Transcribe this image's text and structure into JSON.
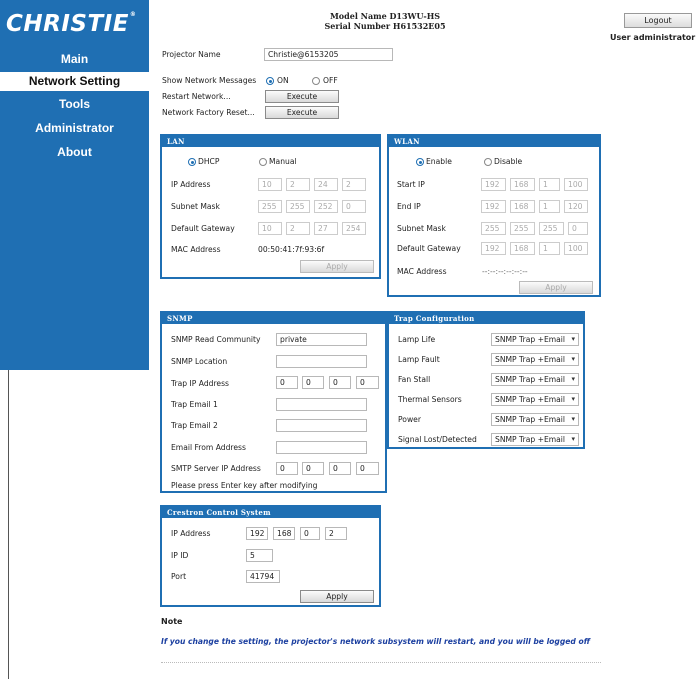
{
  "brand": {
    "logo_text": "CHRISTIE",
    "logo_mark": "®"
  },
  "nav": {
    "items": [
      {
        "label": "Main"
      },
      {
        "label": "Network Setting"
      },
      {
        "label": "Tools"
      },
      {
        "label": "Administrator"
      },
      {
        "label": "About"
      }
    ],
    "active_index": 1
  },
  "header": {
    "model_name": "Model Name D13WU-HS",
    "serial_number": "Serial Number H61532E05",
    "logout_label": "Logout",
    "user_label": "User administrator"
  },
  "general": {
    "projector_name_label": "Projector Name",
    "projector_name_value": "Christie@6153205",
    "show_messages_label": "Show Network Messages",
    "on_label": "ON",
    "off_label": "OFF",
    "show_messages_selected": "ON",
    "restart_label": "Restart Network...",
    "factory_reset_label": "Network Factory Reset...",
    "execute_label": "Execute"
  },
  "lan": {
    "title": "LAN",
    "dhcp_label": "DHCP",
    "manual_label": "Manual",
    "mode_selected": "DHCP",
    "ip_label": "IP Address",
    "ip": [
      "10",
      "2",
      "24",
      "2"
    ],
    "subnet_label": "Subnet Mask",
    "subnet": [
      "255",
      "255",
      "252",
      "0"
    ],
    "gateway_label": "Default Gateway",
    "gateway": [
      "10",
      "2",
      "27",
      "254"
    ],
    "mac_label": "MAC Address",
    "mac_value": "00:50:41:7f:93:6f",
    "apply_label": "Apply"
  },
  "wlan": {
    "title": "WLAN",
    "enable_label": "Enable",
    "disable_label": "Disable",
    "state_selected": "Enable",
    "start_ip_label": "Start IP",
    "start_ip": [
      "192",
      "168",
      "1",
      "100"
    ],
    "end_ip_label": "End IP",
    "end_ip": [
      "192",
      "168",
      "1",
      "120"
    ],
    "subnet_label": "Subnet Mask",
    "subnet": [
      "255",
      "255",
      "255",
      "0"
    ],
    "gateway_label": "Default Gateway",
    "gateway": [
      "192",
      "168",
      "1",
      "100"
    ],
    "mac_label": "MAC Address",
    "mac_value": "--:--:--:--:--:--",
    "apply_label": "Apply"
  },
  "snmp": {
    "title": "SNMP",
    "read_community_label": "SNMP Read Community",
    "read_community_value": "private",
    "location_label": "SNMP Location",
    "location_value": "",
    "trap_ip_label": "Trap IP Address",
    "trap_ip": [
      "0",
      "0",
      "0",
      "0"
    ],
    "trap_email1_label": "Trap Email 1",
    "trap_email1_value": "",
    "trap_email2_label": "Trap Email 2",
    "trap_email2_value": "",
    "email_from_label": "Email From Address",
    "email_from_value": "",
    "smtp_ip_label": "SMTP Server IP Address",
    "smtp_ip": [
      "0",
      "0",
      "0",
      "0"
    ],
    "hint": "Please press Enter key after modifying"
  },
  "trap": {
    "title": "Trap Configuration",
    "rows": [
      {
        "label": "Lamp Life",
        "value": "SNMP Trap +Email"
      },
      {
        "label": "Lamp Fault",
        "value": "SNMP Trap +Email"
      },
      {
        "label": "Fan Stall",
        "value": "SNMP Trap +Email"
      },
      {
        "label": "Thermal Sensors",
        "value": "SNMP Trap +Email"
      },
      {
        "label": "Power",
        "value": "SNMP Trap +Email"
      },
      {
        "label": "Signal Lost/Detected",
        "value": "SNMP Trap +Email"
      }
    ]
  },
  "crestron": {
    "title": "Crestron Control System",
    "ip_label": "IP Address",
    "ip": [
      "192",
      "168",
      "0",
      "2"
    ],
    "ipid_label": "IP ID",
    "ipid_value": "5",
    "port_label": "Port",
    "port_value": "41794",
    "apply_label": "Apply"
  },
  "note": {
    "label": "Note",
    "text": "If you change the setting, the projector's network subsystem will restart, and you will be logged off"
  },
  "colors": {
    "brand_blue": "#1f6fb3",
    "note_blue": "#1b3fa0"
  },
  "icons": [
    "radio-dot-icon",
    "dropdown-arrow-icon"
  ]
}
